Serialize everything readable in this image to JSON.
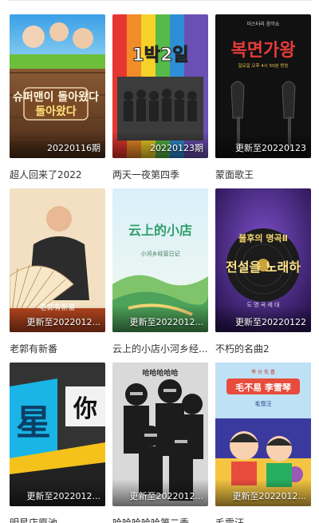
{
  "items": [
    {
      "title": "超人回来了2022",
      "badge": "20220116期",
      "poster_name": "superman-returns-poster"
    },
    {
      "title": "两天一夜第四季",
      "badge": "20220123期",
      "poster_name": "two-days-one-night-poster"
    },
    {
      "title": "蒙面歌王",
      "badge": "更新至20220123",
      "poster_name": "masked-singer-poster"
    },
    {
      "title": "老郭有新番",
      "badge": "更新至2022012...",
      "poster_name": "lao-guo-poster"
    },
    {
      "title": "云上的小店小河乡经...",
      "badge": "更新至2022012...",
      "poster_name": "cloud-shop-poster"
    },
    {
      "title": "不朽的名曲2",
      "badge": "更新至20220122",
      "poster_name": "immortal-songs-poster"
    },
    {
      "title": "明星店原池",
      "badge": "更新至2022012...",
      "poster_name": "star-poster"
    },
    {
      "title": "哈哈哈哈哈第二季",
      "badge": "更新至2022012...",
      "poster_name": "hahaha-poster"
    },
    {
      "title": "毛雪汪",
      "badge": "更新至2022012...",
      "poster_name": "mao-xue-wang-poster"
    }
  ],
  "poster_text": {
    "p1_title": "슈퍼맨이 돌아왔다",
    "p2_title": "1박2일",
    "p3_title": "복면가왕",
    "p3_small": "미스터리 음악쇼",
    "p3_sub": "일요일 오후 4시 50분 방송",
    "p4_small": "老郭有新番",
    "p5_title": "云上的小店",
    "p5_sub": "小河乡经营日记",
    "p6_title": "불후의 명곡Ⅱ",
    "p6_big": "전설을 노래하",
    "p6_sub": "도 명 곡 세 대",
    "p7_a": "你",
    "p7_b": "星",
    "p8_title": "哈哈哈哈哈",
    "p9_title": "毛不易 李雪琴",
    "p9_top": "爷 分 先 喜",
    "p9_sub": "毛雪汪"
  }
}
